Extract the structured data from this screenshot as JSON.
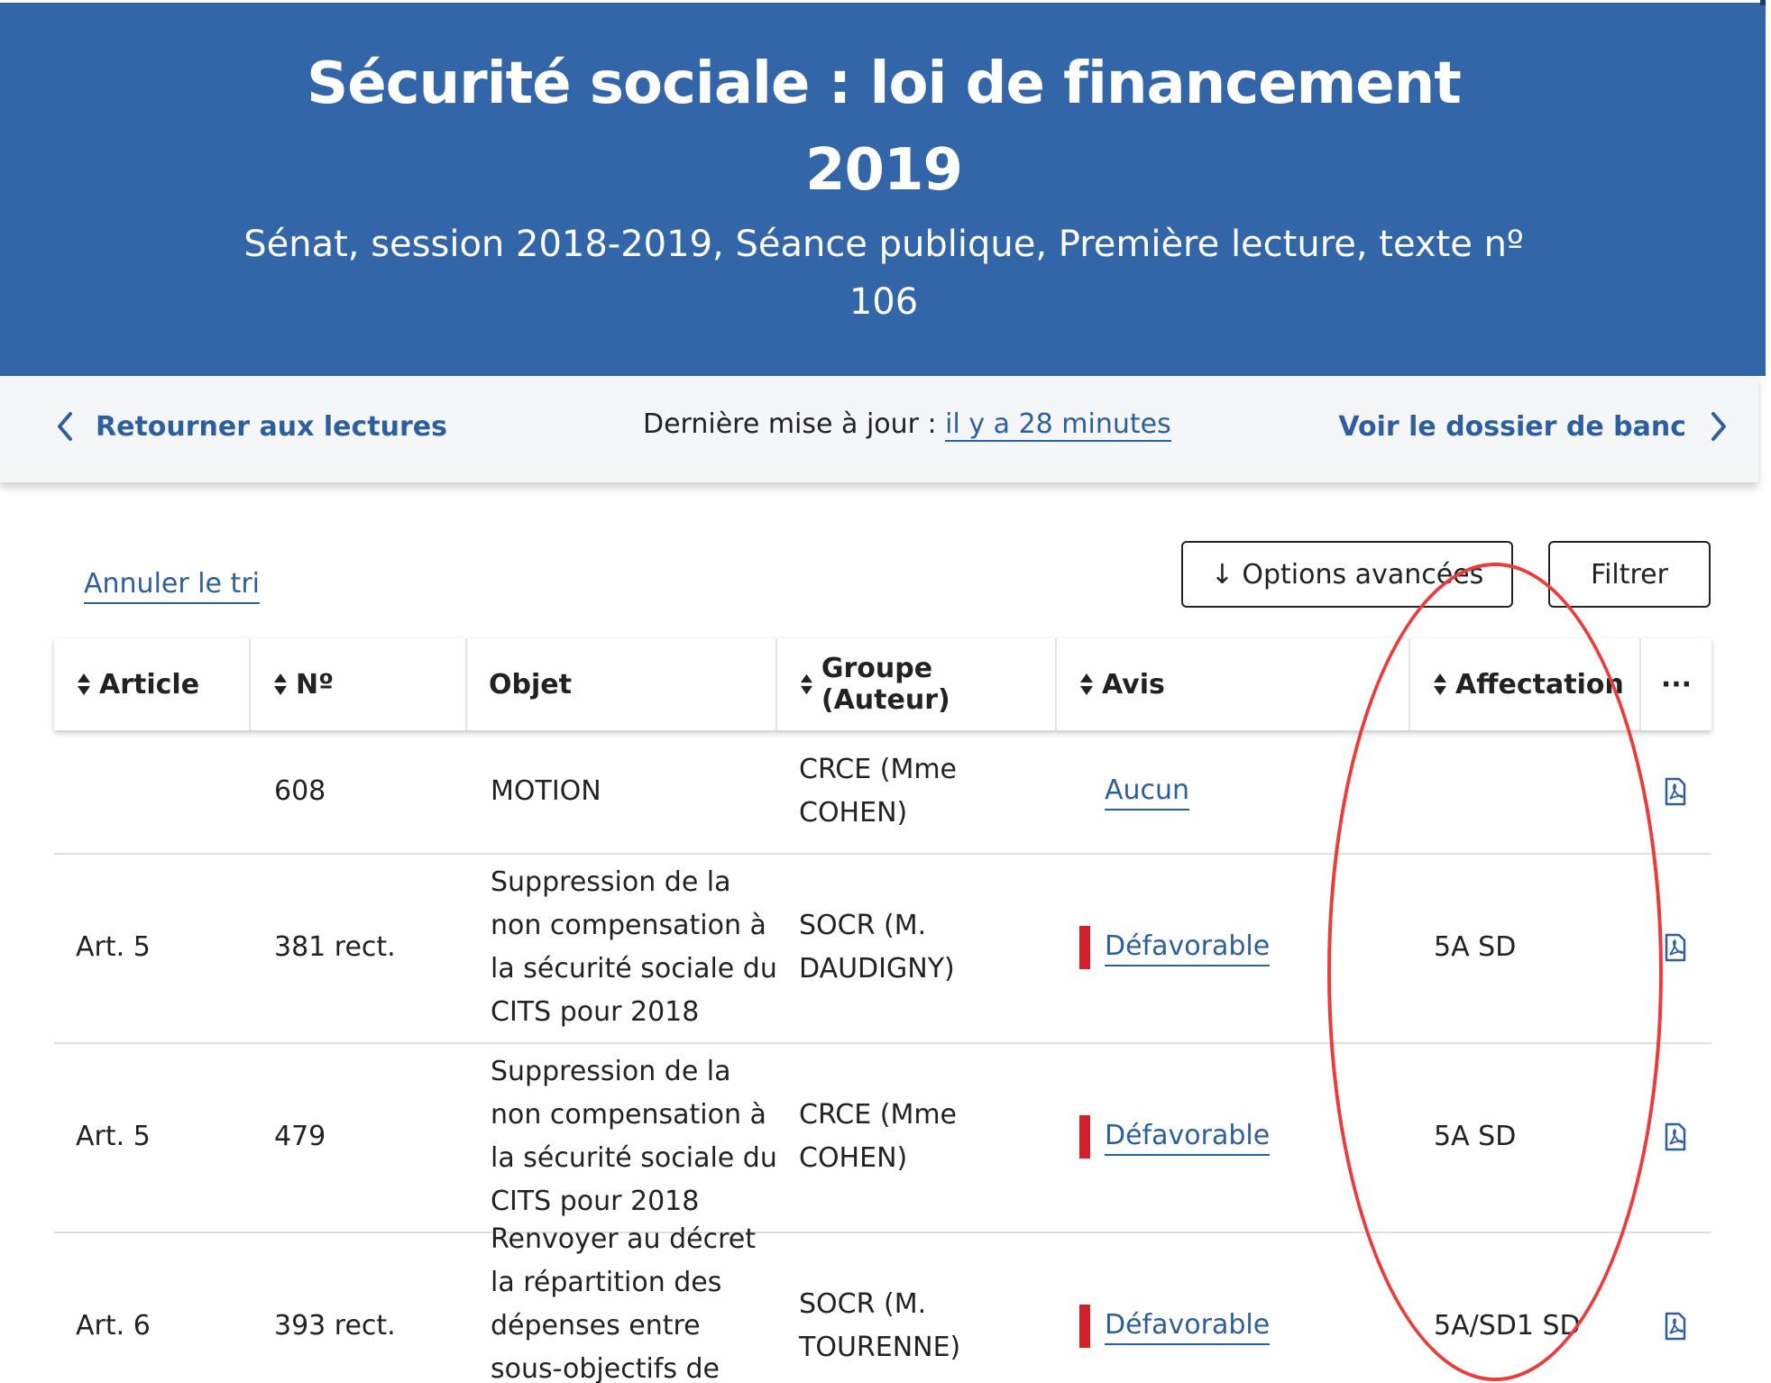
{
  "header": {
    "title": "Sécurité sociale : loi de financement 2019",
    "subtitle": "Sénat, session 2018-2019, Séance publique, Première lecture, texte nº 106"
  },
  "nav": {
    "back_label": "Retourner aux lectures",
    "update_prefix": "Dernière mise à jour : ",
    "update_link": "il y a 28 minutes",
    "dossier_label": "Voir le dossier de banc"
  },
  "controls": {
    "cancel_sort": "Annuler le tri",
    "options_label": "↓ Options avancées",
    "filter_label": "Filtrer"
  },
  "table": {
    "columns": {
      "article": "Article",
      "numero": "Nº",
      "objet": "Objet",
      "groupe": "Groupe (Auteur)",
      "avis": "Avis",
      "affectation": "Affectation",
      "more": "···"
    },
    "rows": [
      {
        "article": "",
        "numero": "608",
        "objet": "MOTION",
        "groupe": "CRCE (Mme COHEN)",
        "avis": "Aucun",
        "avis_marker": false,
        "affectation": ""
      },
      {
        "article": "Art. 5",
        "numero": "381 rect.",
        "objet": "Suppression de la non compensation à la sécurité sociale du CITS pour 2018",
        "groupe": "SOCR (M. DAUDIGNY)",
        "avis": "Défavorable",
        "avis_marker": true,
        "affectation": "5A SD"
      },
      {
        "article": "Art. 5",
        "numero": "479",
        "objet": "Suppression de la non compensation à la sécurité sociale du CITS pour 2018",
        "groupe": "CRCE (Mme COHEN)",
        "avis": "Défavorable",
        "avis_marker": true,
        "affectation": "5A SD"
      },
      {
        "article": "Art. 6",
        "numero": "393 rect.",
        "objet": "Renvoyer au décret la répartition des dépenses entre sous-objectifs de l'ONDAM",
        "groupe": "SOCR (M. TOURENNE)",
        "avis": "Défavorable",
        "avis_marker": true,
        "affectation": "5A/SD1 SD"
      }
    ]
  },
  "colors": {
    "header_bg": "#3366a8",
    "link": "#2d5f9e",
    "defavorable": "#d1202b",
    "annotation": "#ec3b3b"
  },
  "icons": [
    "chevron-left-icon",
    "chevron-right-icon",
    "sort-icon",
    "pdf-icon"
  ]
}
